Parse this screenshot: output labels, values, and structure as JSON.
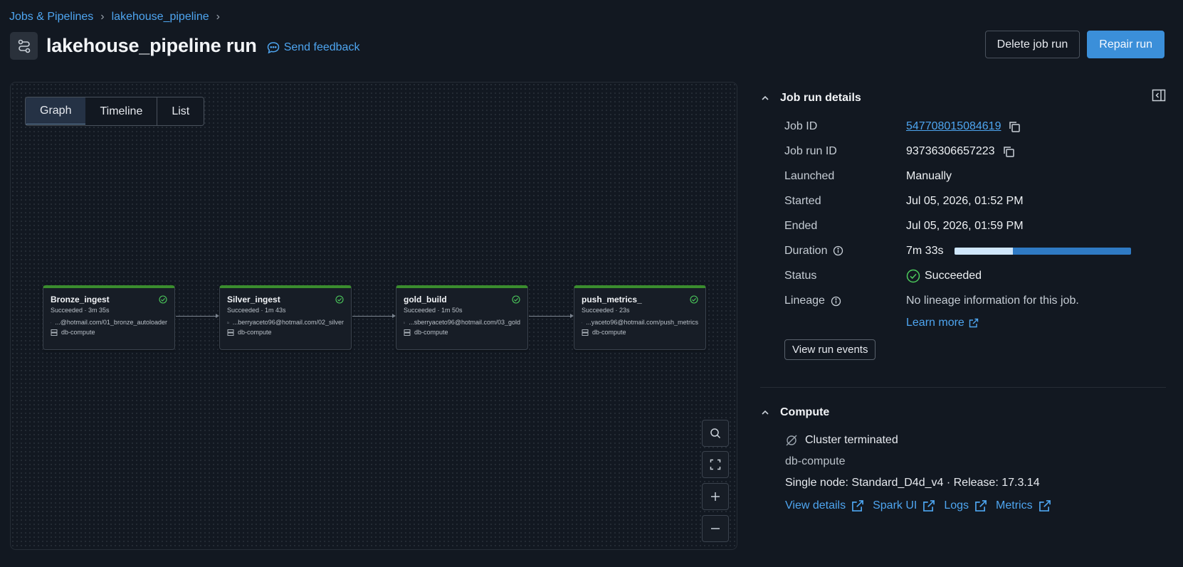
{
  "breadcrumb": {
    "items": [
      "Jobs & Pipelines",
      "lakehouse_pipeline"
    ]
  },
  "header": {
    "title": "lakehouse_pipeline run",
    "feedback_label": "Send feedback",
    "delete_label": "Delete job run",
    "repair_label": "Repair run"
  },
  "view_tabs": {
    "graph": "Graph",
    "timeline": "Timeline",
    "list": "List",
    "active": "Graph"
  },
  "tasks": [
    {
      "name": "Bronze_ingest",
      "status_line": "Succeeded · 3m 35s",
      "path": "...@hotmail.com/01_bronze_autoloader",
      "compute": "db-compute"
    },
    {
      "name": "Silver_ingest",
      "status_line": "Succeeded · 1m 43s",
      "path": "...berryaceto96@hotmail.com/02_silver",
      "compute": "db-compute"
    },
    {
      "name": "gold_build",
      "status_line": "Succeeded · 1m 50s",
      "path": "...sberryaceto96@hotmail.com/03_gold",
      "compute": "db-compute"
    },
    {
      "name": "push_metrics_",
      "status_line": "Succeeded · 23s",
      "path": "...yaceto96@hotmail.com/push_metrics",
      "compute": "db-compute"
    }
  ],
  "details": {
    "title": "Job run details",
    "job_id_label": "Job ID",
    "job_id": "547708015084619",
    "run_id_label": "Job run ID",
    "run_id": "93736306657223",
    "launched_label": "Launched",
    "launched": "Manually",
    "started_label": "Started",
    "started": "Jul 05, 2026, 01:52 PM",
    "ended_label": "Ended",
    "ended": "Jul 05, 2026, 01:59 PM",
    "duration_label": "Duration",
    "duration": "7m 33s",
    "duration_bar_fraction": 0.33,
    "status_label": "Status",
    "status": "Succeeded",
    "lineage_label": "Lineage",
    "lineage": "No lineage information for this job.",
    "learn_more": "Learn more",
    "view_events": "View run events"
  },
  "compute": {
    "title": "Compute",
    "state": "Cluster terminated",
    "name": "db-compute",
    "spec": "Single node: Standard_D4d_v4 · Release: 17.3.14",
    "links": [
      "View details",
      "Spark UI",
      "Logs",
      "Metrics"
    ]
  },
  "colors": {
    "accent": "#3b8fd9",
    "success": "#3a8d2e",
    "link": "#4ea5f0",
    "background": "#121821"
  }
}
